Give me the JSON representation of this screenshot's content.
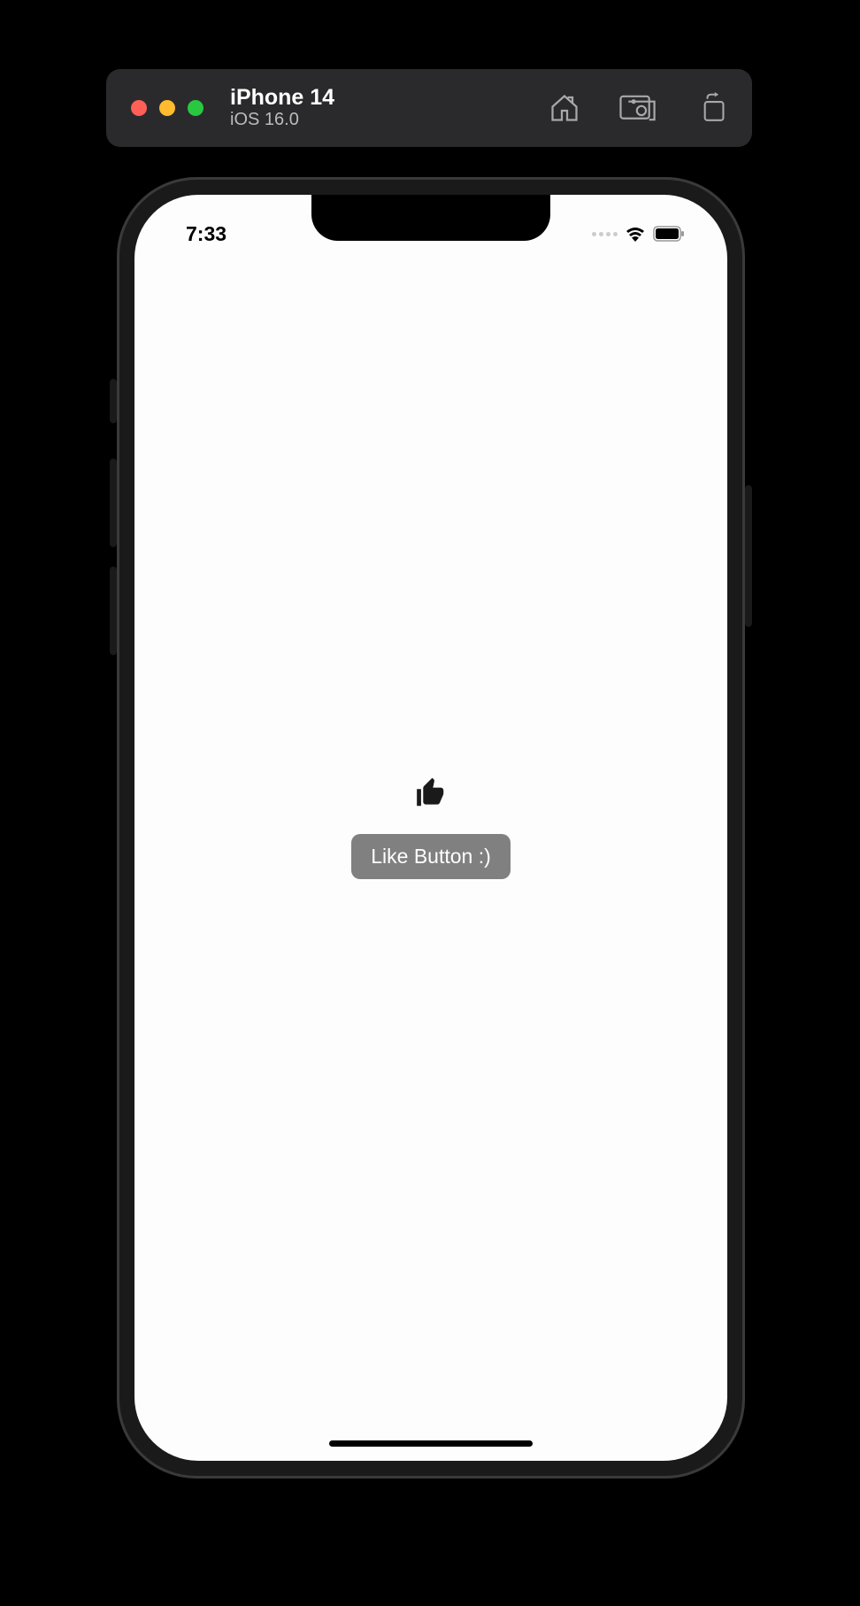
{
  "simulator": {
    "device_name": "iPhone 14",
    "os_version": "iOS 16.0"
  },
  "status_bar": {
    "time": "7:33"
  },
  "app": {
    "button_label": "Like Button :)"
  }
}
